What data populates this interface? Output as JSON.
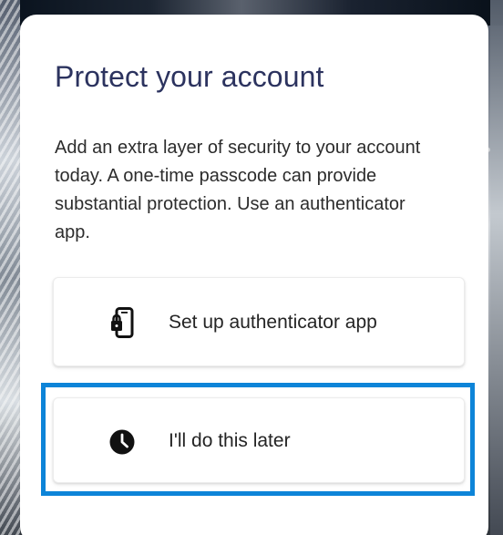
{
  "dialog": {
    "title": "Protect your account",
    "description": "Add an extra layer of security to your account today. A one-time passcode can provide substantial protection. Use an authenticator app."
  },
  "options": [
    {
      "label": "Set up authenticator app",
      "icon": "phone-lock-icon"
    },
    {
      "label": "I'll do this later",
      "icon": "clock-icon"
    }
  ],
  "colors": {
    "title": "#2c335f",
    "text": "#2c2c2c",
    "selection_outline": "#0d84d8",
    "dialog_background": "#ffffff"
  }
}
